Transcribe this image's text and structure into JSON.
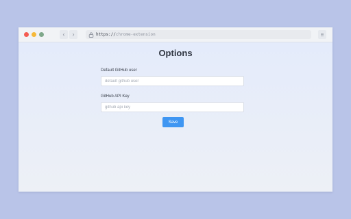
{
  "browser": {
    "url_scheme": "https://",
    "url_rest": "chrome-extension",
    "back_icon": "chevron-left-icon",
    "forward_icon": "chevron-right-icon",
    "lock_icon": "lock-icon",
    "menu_icon": "menu-icon"
  },
  "page": {
    "title": "Options",
    "fields": {
      "user_label": "Default GitHub user",
      "user_placeholder": "default github user",
      "user_value": "",
      "key_label": "GitHub API Key",
      "key_placeholder": "github api key",
      "key_value": ""
    },
    "save_label": "Save"
  },
  "colors": {
    "background": "#b9c4e8",
    "accent": "#3f96f2",
    "traffic_red": "#f45c52",
    "traffic_yellow": "#f6b93a",
    "traffic_green": "#7fa88b"
  }
}
